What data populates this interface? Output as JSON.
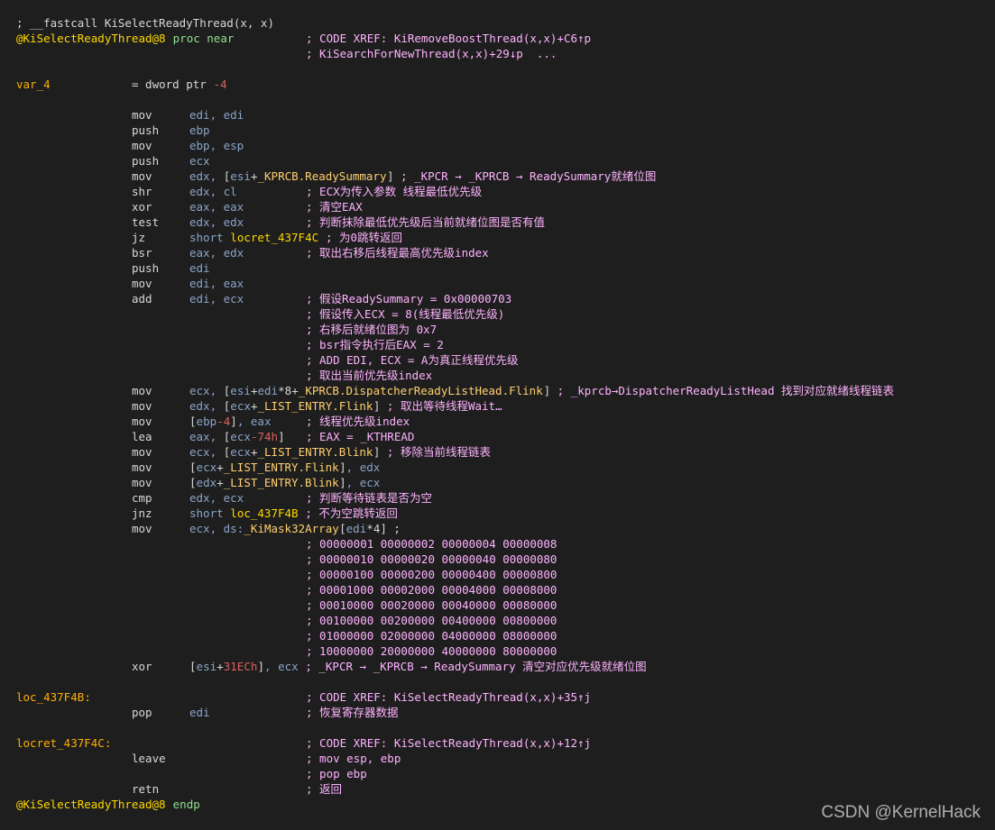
{
  "colors": {
    "background": "#1e1e1e",
    "comment": "#ffb3ff",
    "function_name": "#ffd800",
    "label": "#ffb000",
    "keyword": "#8fe08f",
    "register": "#8aa4c8",
    "immediate_number": "#e06060",
    "plain": "#d8d8d8"
  },
  "lines": [
    [
      [
        "plain",
        "; __fastcall KiSelectReadyThread(x, x)"
      ]
    ],
    [
      [
        "func",
        "@KiSelectReadyThread@8"
      ],
      [
        "sp",
        " "
      ],
      [
        "kw",
        "proc near"
      ],
      [
        "pad",
        40
      ],
      [
        "comment",
        "; CODE XREF: KiRemoveBoostThread(x,x)+C6↑p"
      ]
    ],
    [
      [
        "pad",
        40
      ],
      [
        "comment",
        "; KiSearchForNewThread(x,x)+29↓p  ..."
      ]
    ],
    [],
    [
      [
        "label",
        "var_4"
      ],
      [
        "pad",
        16
      ],
      [
        "plain",
        "= dword ptr "
      ],
      [
        "num",
        "-4"
      ]
    ],
    [],
    [
      [
        "pad",
        16
      ],
      [
        "mnem",
        "mov"
      ],
      [
        "pad",
        24
      ],
      [
        "reg",
        "edi, edi"
      ]
    ],
    [
      [
        "pad",
        16
      ],
      [
        "mnem",
        "push"
      ],
      [
        "pad",
        24
      ],
      [
        "reg",
        "ebp"
      ]
    ],
    [
      [
        "pad",
        16
      ],
      [
        "mnem",
        "mov"
      ],
      [
        "pad",
        24
      ],
      [
        "reg",
        "ebp, esp"
      ]
    ],
    [
      [
        "pad",
        16
      ],
      [
        "mnem",
        "push"
      ],
      [
        "pad",
        24
      ],
      [
        "reg",
        "ecx"
      ]
    ],
    [
      [
        "pad",
        16
      ],
      [
        "mnem",
        "mov"
      ],
      [
        "pad",
        24
      ],
      [
        "reg",
        "edx, "
      ],
      [
        "plain",
        "["
      ],
      [
        "reg",
        "esi"
      ],
      [
        "plain",
        "+"
      ],
      [
        "struct",
        "_KPRCB.ReadySummary"
      ],
      [
        "plain",
        "]"
      ],
      [
        "comment",
        " ; _KPCR → _KPRCB → ReadySummary就绪位图"
      ]
    ],
    [
      [
        "pad",
        16
      ],
      [
        "mnem",
        "shr"
      ],
      [
        "pad",
        24
      ],
      [
        "reg",
        "edx, cl"
      ],
      [
        "pad",
        40
      ],
      [
        "comment",
        "; ECX为传入参数 线程最低优先级"
      ]
    ],
    [
      [
        "pad",
        16
      ],
      [
        "mnem",
        "xor"
      ],
      [
        "pad",
        24
      ],
      [
        "reg",
        "eax, eax"
      ],
      [
        "pad",
        40
      ],
      [
        "comment",
        "; 清空EAX"
      ]
    ],
    [
      [
        "pad",
        16
      ],
      [
        "mnem",
        "test"
      ],
      [
        "pad",
        24
      ],
      [
        "reg",
        "edx, edx"
      ],
      [
        "pad",
        40
      ],
      [
        "comment",
        "; 判断抹除最低优先级后当前就绪位图是否有值"
      ]
    ],
    [
      [
        "pad",
        16
      ],
      [
        "mnem",
        "jz"
      ],
      [
        "pad",
        24
      ],
      [
        "reg",
        "short "
      ],
      [
        "loc",
        "locret_437F4C"
      ],
      [
        "comment",
        " ; 为0跳转返回"
      ]
    ],
    [
      [
        "pad",
        16
      ],
      [
        "mnem",
        "bsr"
      ],
      [
        "pad",
        24
      ],
      [
        "reg",
        "eax, edx"
      ],
      [
        "pad",
        40
      ],
      [
        "comment",
        "; 取出右移后线程最高优先级index"
      ]
    ],
    [
      [
        "pad",
        16
      ],
      [
        "mnem",
        "push"
      ],
      [
        "pad",
        24
      ],
      [
        "reg",
        "edi"
      ]
    ],
    [
      [
        "pad",
        16
      ],
      [
        "mnem",
        "mov"
      ],
      [
        "pad",
        24
      ],
      [
        "reg",
        "edi, eax"
      ]
    ],
    [
      [
        "pad",
        16
      ],
      [
        "mnem",
        "add"
      ],
      [
        "pad",
        24
      ],
      [
        "reg",
        "edi, ecx"
      ],
      [
        "pad",
        40
      ],
      [
        "comment",
        "; 假设ReadySummary = 0x00000703"
      ]
    ],
    [
      [
        "pad",
        40
      ],
      [
        "comment",
        "; 假设传入ECX = 8(线程最低优先级)"
      ]
    ],
    [
      [
        "pad",
        40
      ],
      [
        "comment",
        "; 右移后就绪位图为 0x7"
      ]
    ],
    [
      [
        "pad",
        40
      ],
      [
        "comment",
        "; bsr指令执行后EAX = 2"
      ]
    ],
    [
      [
        "pad",
        40
      ],
      [
        "comment",
        "; ADD EDI, ECX = A为真正线程优先级"
      ]
    ],
    [
      [
        "pad",
        40
      ],
      [
        "comment",
        "; 取出当前优先级index"
      ]
    ],
    [
      [
        "pad",
        16
      ],
      [
        "mnem",
        "mov"
      ],
      [
        "pad",
        24
      ],
      [
        "reg",
        "ecx, "
      ],
      [
        "plain",
        "["
      ],
      [
        "reg",
        "esi"
      ],
      [
        "plain",
        "+"
      ],
      [
        "reg",
        "edi"
      ],
      [
        "plain",
        "*8+"
      ],
      [
        "struct",
        "_KPRCB.DispatcherReadyListHead.Flink"
      ],
      [
        "plain",
        "]"
      ],
      [
        "comment",
        " ; _kprcb→DispatcherReadyListHead 找到对应就绪线程链表"
      ]
    ],
    [
      [
        "pad",
        16
      ],
      [
        "mnem",
        "mov"
      ],
      [
        "pad",
        24
      ],
      [
        "reg",
        "edx, "
      ],
      [
        "plain",
        "["
      ],
      [
        "reg",
        "ecx"
      ],
      [
        "plain",
        "+"
      ],
      [
        "struct",
        "_LIST_ENTRY.Flink"
      ],
      [
        "plain",
        "]"
      ],
      [
        "comment",
        " ; 取出等待线程Wait…"
      ]
    ],
    [
      [
        "pad",
        16
      ],
      [
        "mnem",
        "mov"
      ],
      [
        "pad",
        24
      ],
      [
        "plain",
        "["
      ],
      [
        "reg",
        "ebp"
      ],
      [
        "num",
        "-4"
      ],
      [
        "plain",
        "]"
      ],
      [
        "reg",
        ", eax"
      ],
      [
        "pad",
        40
      ],
      [
        "comment",
        "; 线程优先级index"
      ]
    ],
    [
      [
        "pad",
        16
      ],
      [
        "mnem",
        "lea"
      ],
      [
        "pad",
        24
      ],
      [
        "reg",
        "eax, "
      ],
      [
        "plain",
        "["
      ],
      [
        "reg",
        "ecx"
      ],
      [
        "num",
        "-74h"
      ],
      [
        "plain",
        "]"
      ],
      [
        "pad",
        40
      ],
      [
        "comment",
        "; EAX = _KTHREAD"
      ]
    ],
    [
      [
        "pad",
        16
      ],
      [
        "mnem",
        "mov"
      ],
      [
        "pad",
        24
      ],
      [
        "reg",
        "ecx, "
      ],
      [
        "plain",
        "["
      ],
      [
        "reg",
        "ecx"
      ],
      [
        "plain",
        "+"
      ],
      [
        "struct",
        "_LIST_ENTRY.Blink"
      ],
      [
        "plain",
        "]"
      ],
      [
        "comment",
        " ; 移除当前线程链表"
      ]
    ],
    [
      [
        "pad",
        16
      ],
      [
        "mnem",
        "mov"
      ],
      [
        "pad",
        24
      ],
      [
        "plain",
        "["
      ],
      [
        "reg",
        "ecx"
      ],
      [
        "plain",
        "+"
      ],
      [
        "struct",
        "_LIST_ENTRY.Flink"
      ],
      [
        "plain",
        "]"
      ],
      [
        "reg",
        ", edx"
      ]
    ],
    [
      [
        "pad",
        16
      ],
      [
        "mnem",
        "mov"
      ],
      [
        "pad",
        24
      ],
      [
        "plain",
        "["
      ],
      [
        "reg",
        "edx"
      ],
      [
        "plain",
        "+"
      ],
      [
        "struct",
        "_LIST_ENTRY.Blink"
      ],
      [
        "plain",
        "]"
      ],
      [
        "reg",
        ", ecx"
      ]
    ],
    [
      [
        "pad",
        16
      ],
      [
        "mnem",
        "cmp"
      ],
      [
        "pad",
        24
      ],
      [
        "reg",
        "edx, ecx"
      ],
      [
        "pad",
        40
      ],
      [
        "comment",
        "; 判断等待链表是否为空"
      ]
    ],
    [
      [
        "pad",
        16
      ],
      [
        "mnem",
        "jnz"
      ],
      [
        "pad",
        24
      ],
      [
        "reg",
        "short "
      ],
      [
        "loc",
        "loc_437F4B"
      ],
      [
        "comment",
        " ; 不为空跳转返回"
      ]
    ],
    [
      [
        "pad",
        16
      ],
      [
        "mnem",
        "mov"
      ],
      [
        "pad",
        24
      ],
      [
        "reg",
        "ecx, ds:"
      ],
      [
        "struct",
        "_KiMask32Array"
      ],
      [
        "plain",
        "["
      ],
      [
        "reg",
        "edi"
      ],
      [
        "plain",
        "*4] ;"
      ]
    ],
    [
      [
        "pad",
        40
      ],
      [
        "comment",
        "; 00000001 00000002 00000004 00000008"
      ]
    ],
    [
      [
        "pad",
        40
      ],
      [
        "comment",
        "; 00000010 00000020 00000040 00000080"
      ]
    ],
    [
      [
        "pad",
        40
      ],
      [
        "comment",
        "; 00000100 00000200 00000400 00000800"
      ]
    ],
    [
      [
        "pad",
        40
      ],
      [
        "comment",
        "; 00001000 00002000 00004000 00008000"
      ]
    ],
    [
      [
        "pad",
        40
      ],
      [
        "comment",
        "; 00010000 00020000 00040000 00080000"
      ]
    ],
    [
      [
        "pad",
        40
      ],
      [
        "comment",
        "; 00100000 00200000 00400000 00800000"
      ]
    ],
    [
      [
        "pad",
        40
      ],
      [
        "comment",
        "; 01000000 02000000 04000000 08000000"
      ]
    ],
    [
      [
        "pad",
        40
      ],
      [
        "comment",
        "; 10000000 20000000 40000000 80000000"
      ]
    ],
    [
      [
        "pad",
        16
      ],
      [
        "mnem",
        "xor"
      ],
      [
        "pad",
        24
      ],
      [
        "plain",
        "["
      ],
      [
        "reg",
        "esi"
      ],
      [
        "plain",
        "+"
      ],
      [
        "num",
        "31ECh"
      ],
      [
        "plain",
        "]"
      ],
      [
        "reg",
        ", ecx"
      ],
      [
        "comment",
        " ; _KPCR → _KPRCB → ReadySummary 清空对应优先级就绪位图"
      ]
    ],
    [],
    [
      [
        "label",
        "loc_437F4B:"
      ],
      [
        "pad",
        40
      ],
      [
        "comment",
        "; CODE XREF: KiSelectReadyThread(x,x)+35↑j"
      ]
    ],
    [
      [
        "pad",
        16
      ],
      [
        "mnem",
        "pop"
      ],
      [
        "pad",
        24
      ],
      [
        "reg",
        "edi"
      ],
      [
        "pad",
        40
      ],
      [
        "comment",
        "; 恢复寄存器数据"
      ]
    ],
    [],
    [
      [
        "label",
        "locret_437F4C:"
      ],
      [
        "pad",
        40
      ],
      [
        "comment",
        "; CODE XREF: KiSelectReadyThread(x,x)+12↑j"
      ]
    ],
    [
      [
        "pad",
        16
      ],
      [
        "mnem",
        "leave"
      ],
      [
        "pad",
        40
      ],
      [
        "comment",
        "; mov esp, ebp"
      ]
    ],
    [
      [
        "pad",
        40
      ],
      [
        "comment",
        "; pop ebp"
      ]
    ],
    [
      [
        "pad",
        16
      ],
      [
        "mnem",
        "retn"
      ],
      [
        "pad",
        40
      ],
      [
        "comment",
        "; 返回"
      ]
    ],
    [
      [
        "func",
        "@KiSelectReadyThread@8"
      ],
      [
        "sp",
        " "
      ],
      [
        "kw",
        "endp"
      ]
    ]
  ],
  "watermark": "CSDN @KernelHack"
}
